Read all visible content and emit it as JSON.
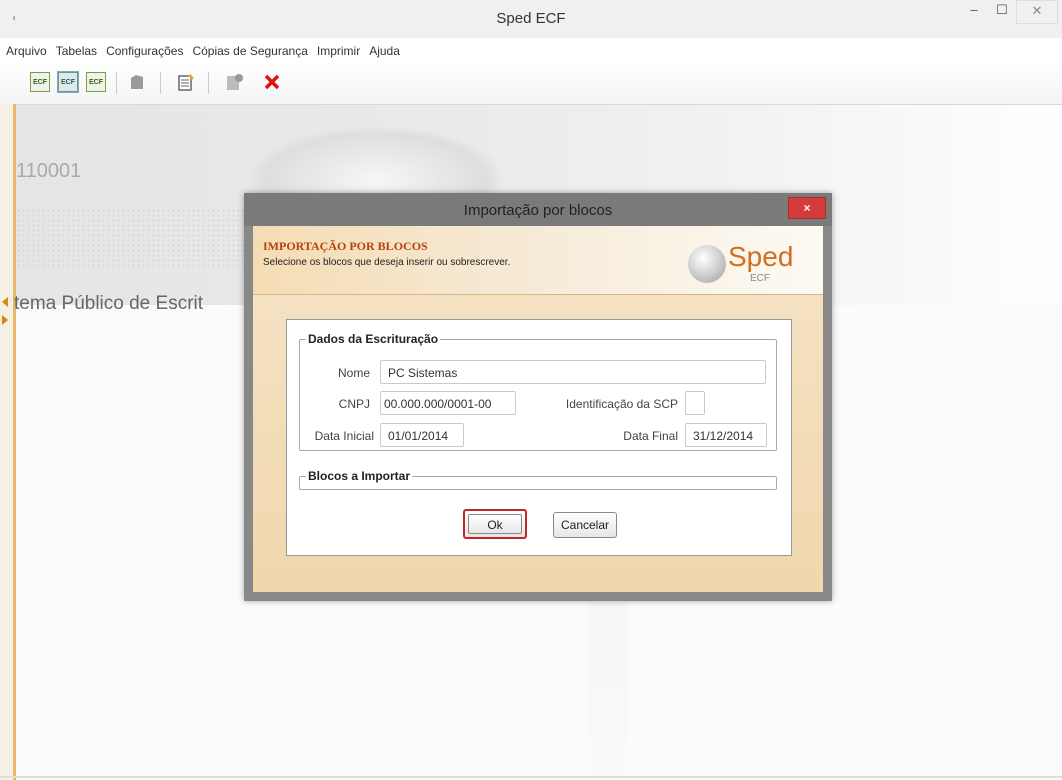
{
  "window": {
    "title": "Sped ECF",
    "controls": {
      "minimize": "–",
      "maximize": "☐",
      "close": "✕"
    }
  },
  "menubar": {
    "items": [
      "Arquivo",
      "Tabelas",
      "Configurações",
      "Cópias de Segurança",
      "Imprimir",
      "Ajuda"
    ]
  },
  "toolbar": {
    "ecf_label": "ECF"
  },
  "background": {
    "code": "110001",
    "sistema_text": "tema Público de Escrit"
  },
  "dialog": {
    "title": "Importação por blocos",
    "close_symbol": "×",
    "header_title": "IMPORTAÇÃO POR BLOCOS",
    "header_subtitle": "Selecione os blocos que deseja inserir ou sobrescrever.",
    "logo_word": "Sped",
    "logo_sub": "ECF",
    "dados": {
      "legend": "Dados da Escrituração",
      "nome_label": "Nome",
      "nome_value": "PC Sistemas",
      "cnpj_label": "CNPJ",
      "cnpj_value": "00.000.000/0001-00",
      "scp_label": "Identificação da SCP",
      "scp_value": "",
      "data_inicial_label": "Data Inicial",
      "data_inicial_value": "01/01/2014",
      "data_final_label": "Data Final",
      "data_final_value": "31/12/2014"
    },
    "blocos_legend": "Blocos a Importar",
    "ok_label": "Ok",
    "cancel_label": "Cancelar"
  },
  "colors": {
    "accent_orange": "#d46e1a",
    "header_title": "#b8420d",
    "highlight_red": "#c5262c",
    "close_red": "#d53b3b"
  }
}
